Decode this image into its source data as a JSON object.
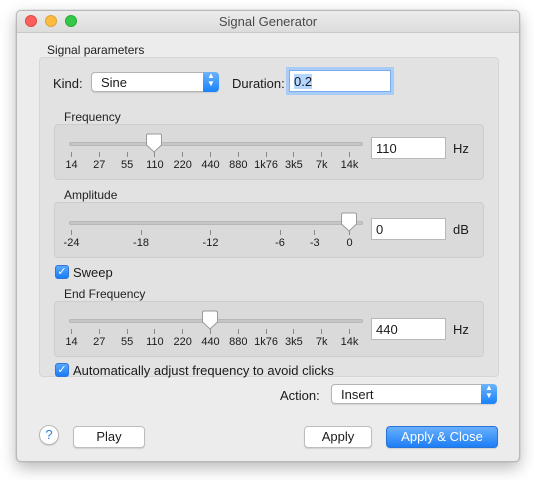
{
  "window": {
    "title": "Signal Generator"
  },
  "signal_parameters": {
    "group_label": "Signal parameters",
    "kind_label": "Kind:",
    "kind_value": "Sine",
    "duration_label": "Duration:",
    "duration_value": "0.2"
  },
  "frequency": {
    "label": "Frequency",
    "value": "110",
    "unit": "Hz",
    "ticks": [
      "14",
      "27",
      "55",
      "110",
      "220",
      "440",
      "880",
      "1k76",
      "3k5",
      "7k",
      "14k"
    ],
    "slider_tick_index": 3
  },
  "amplitude": {
    "label": "Amplitude",
    "value": "0",
    "unit": "dB",
    "ticks": [
      "-24",
      "-18",
      "-12",
      "-6",
      "-3",
      "0"
    ],
    "slider_value_db": 0
  },
  "sweep": {
    "label": "Sweep",
    "checked": true
  },
  "end_frequency": {
    "label": "End Frequency",
    "value": "440",
    "unit": "Hz",
    "ticks": [
      "14",
      "27",
      "55",
      "110",
      "220",
      "440",
      "880",
      "1k76",
      "3k5",
      "7k",
      "14k"
    ],
    "slider_tick_index": 5
  },
  "auto_adjust": {
    "label": "Automatically adjust frequency to avoid clicks",
    "checked": true
  },
  "action": {
    "label": "Action:",
    "value": "Insert"
  },
  "buttons": {
    "help": "?",
    "play": "Play",
    "apply": "Apply",
    "apply_close": "Apply & Close"
  },
  "colors": {
    "accent": "#1a82fb",
    "close": "#fc605b",
    "minimize": "#fdbc40",
    "maximize": "#34c84a"
  }
}
